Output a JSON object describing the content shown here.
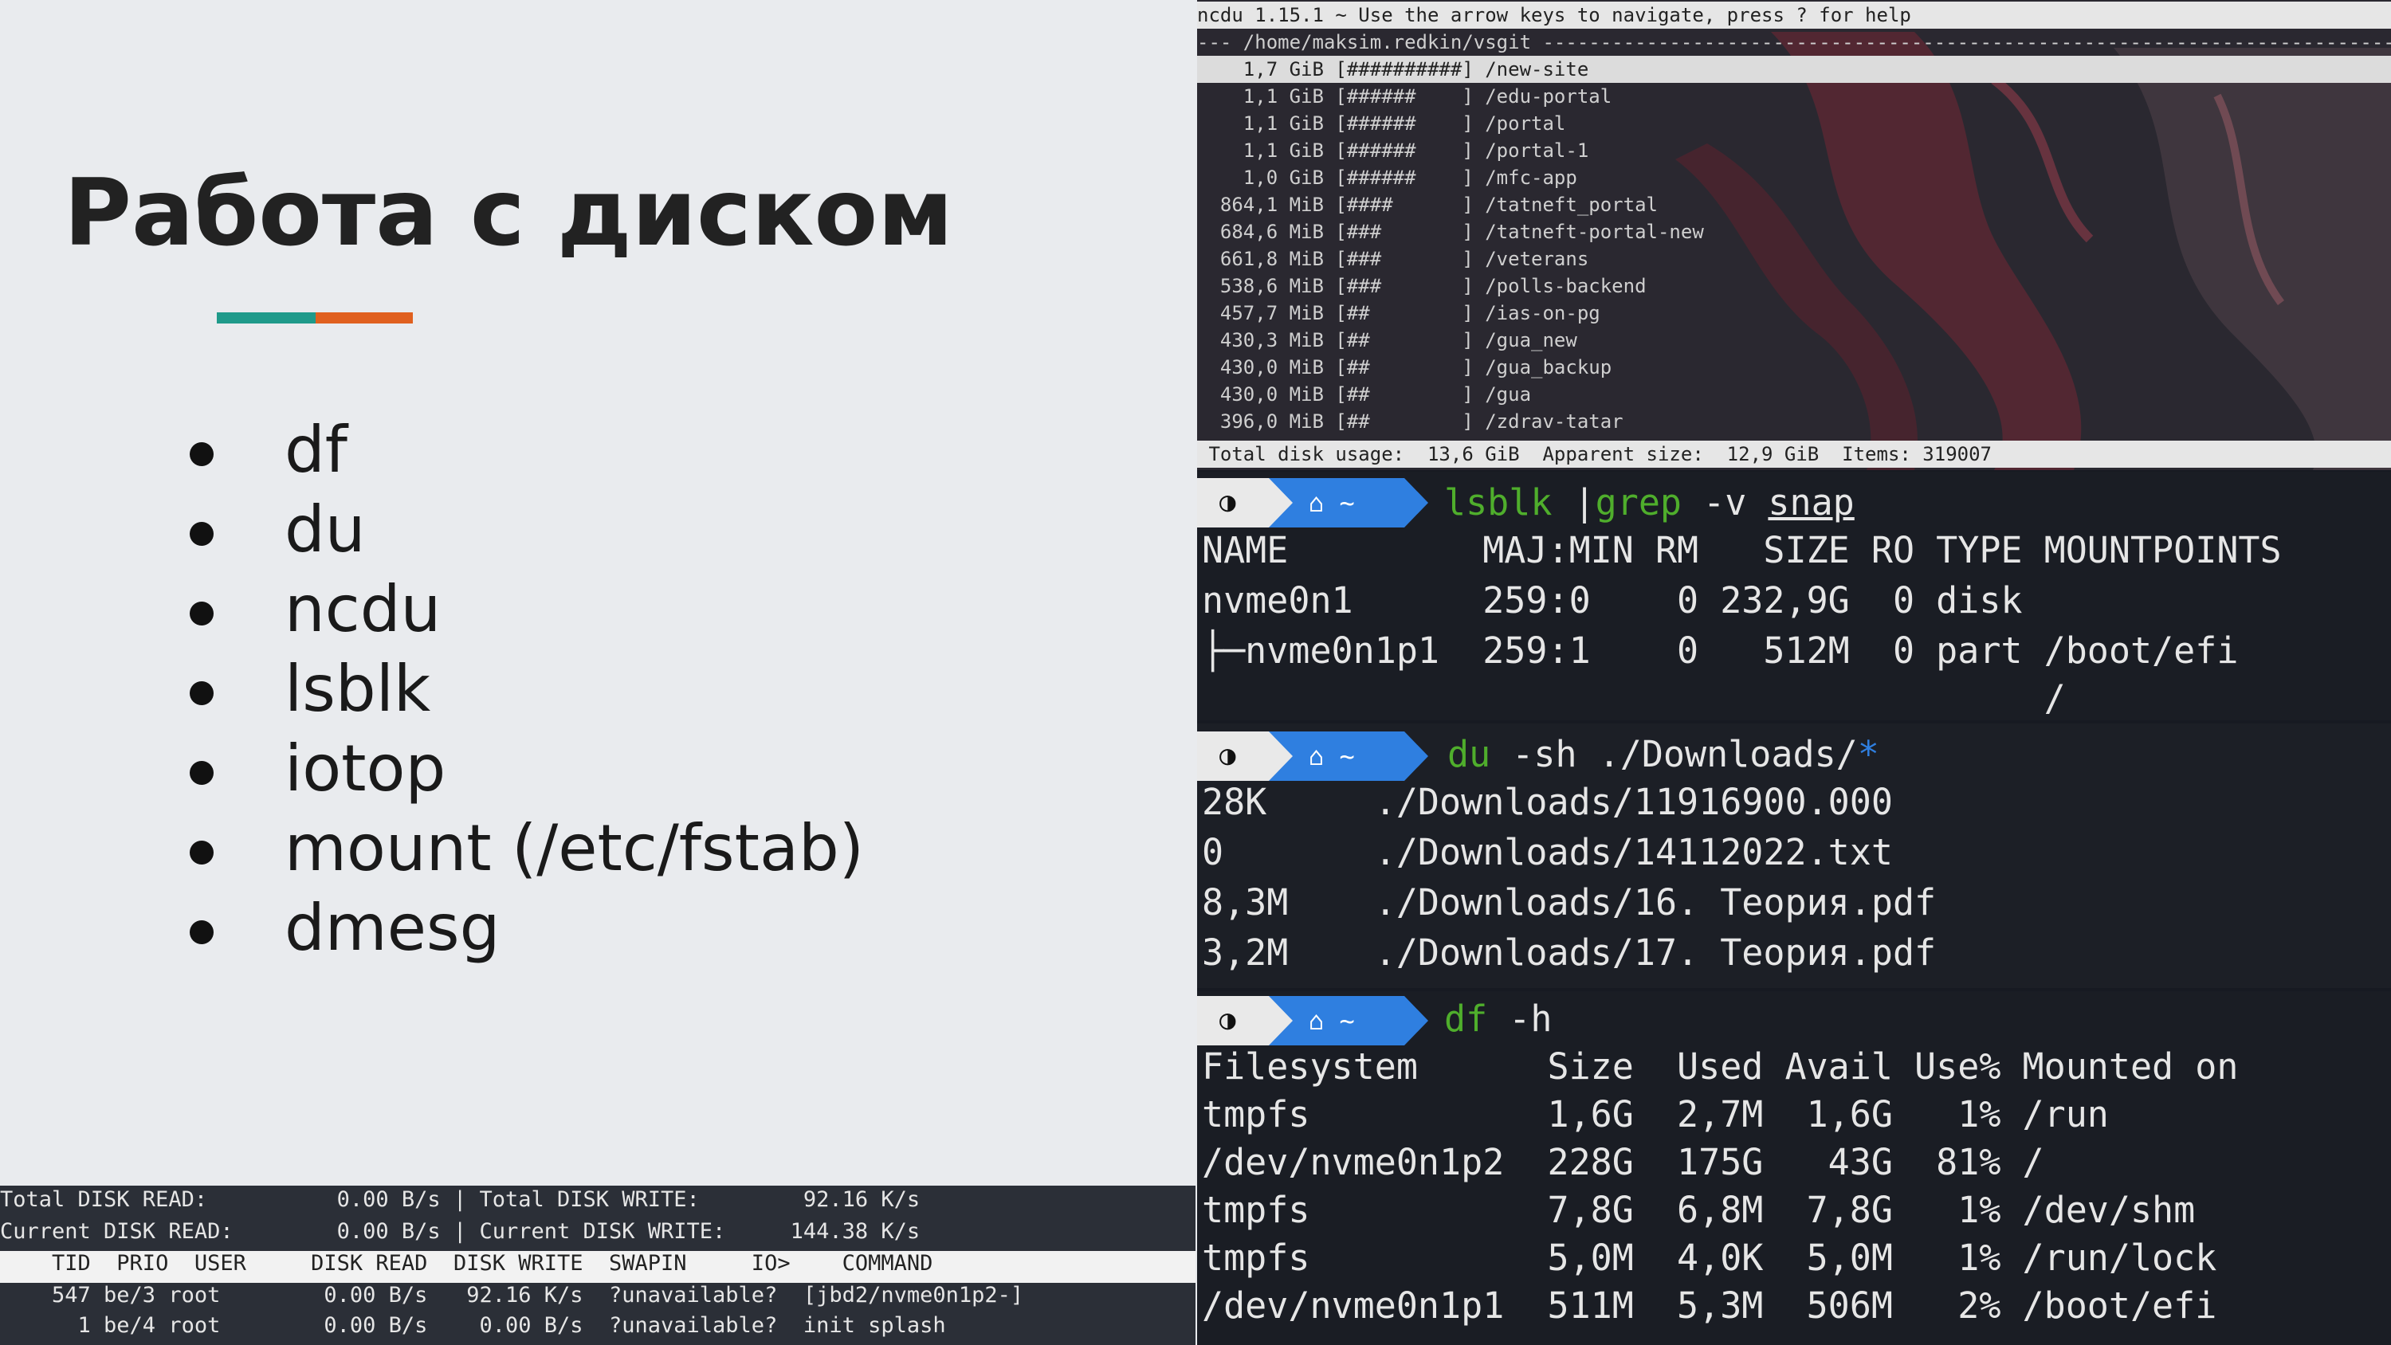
{
  "slide": {
    "title": "Работа с диском",
    "bullets": [
      "df",
      "du",
      "ncdu",
      "lsblk",
      "iotop",
      "mount (/etc/fstab)",
      "dmesg"
    ],
    "accent_colors": [
      "#1f9a8a",
      "#e0601f"
    ]
  },
  "iotop": {
    "total_read": "Total DISK READ:          0.00 B/s | Total DISK WRITE:        92.16 K/s",
    "current_read": "Current DISK READ:        0.00 B/s | Current DISK WRITE:     144.38 K/s",
    "header": "    TID  PRIO  USER     DISK READ  DISK WRITE  SWAPIN     IO>    COMMAND",
    "rows": [
      "    547 be/3 root        0.00 B/s   92.16 K/s  ?unavailable?  [jbd2/nvme0n1p2-]",
      "      1 be/4 root        0.00 B/s    0.00 B/s  ?unavailable?  init splash"
    ]
  },
  "ncdu": {
    "topbar": "ncdu 1.15.1 ~ Use the arrow keys to navigate, press ? for help",
    "path": "--- /home/maksim.redkin/vsgit ---------------------------------------------------------------------------",
    "entries": [
      "    1,7 GiB [##########] /new-site",
      "    1,1 GiB [######    ] /edu-portal",
      "    1,1 GiB [######    ] /portal",
      "    1,1 GiB [######    ] /portal-1",
      "    1,0 GiB [######    ] /mfc-app",
      "  864,1 MiB [####      ] /tatneft_portal",
      "  684,6 MiB [###       ] /tatneft-portal-new",
      "  661,8 MiB [###       ] /veterans",
      "  538,6 MiB [###       ] /polls-backend",
      "  457,7 MiB [##        ] /ias-on-pg",
      "  430,3 MiB [##        ] /gua_new",
      "  430,0 MiB [##        ] /gua_backup",
      "  430,0 MiB [##        ] /gua",
      "  396,0 MiB [##        ] /zdrav-tatar"
    ],
    "footer": " Total disk usage:  13,6 GiB  Apparent size:  12,9 GiB  Items: 319007"
  },
  "lsblk": {
    "cmd1": "lsblk",
    "pipe": " |",
    "cmd2": "grep",
    "args": " -v ",
    "arg_ul": "snap",
    "lines": [
      "NAME         MAJ:MIN RM   SIZE RO TYPE MOUNTPOINTS",
      "nvme0n1      259:0    0 232,9G  0 disk",
      "├─nvme0n1p1  259:1    0   512M  0 part /boot/efi",
      "                                       /"
    ]
  },
  "du": {
    "cmd": "du",
    "args": " -sh ./Downloads/",
    "glob": "*",
    "lines": [
      "28K     ./Downloads/11916900.000",
      "0       ./Downloads/14112022.txt",
      "8,3M    ./Downloads/16. Теория.pdf",
      "3,2M    ./Downloads/17. Теория.pdf"
    ]
  },
  "df": {
    "cmd": "df",
    "args": " -h",
    "lines": [
      "Filesystem      Size  Used Avail Use% Mounted on",
      "tmpfs           1,6G  2,7M  1,6G   1% /run",
      "/dev/nvme0n1p2  228G  175G   43G  81% /",
      "tmpfs           7,8G  6,8M  7,8G   1% /dev/shm",
      "tmpfs           5,0M  4,0K  5,0M   1% /run/lock",
      "/dev/nvme0n1p1  511M  5,3M  506M   2% /boot/efi"
    ]
  },
  "prompt": {
    "home": "⌂ ~",
    "logo": "◑"
  }
}
